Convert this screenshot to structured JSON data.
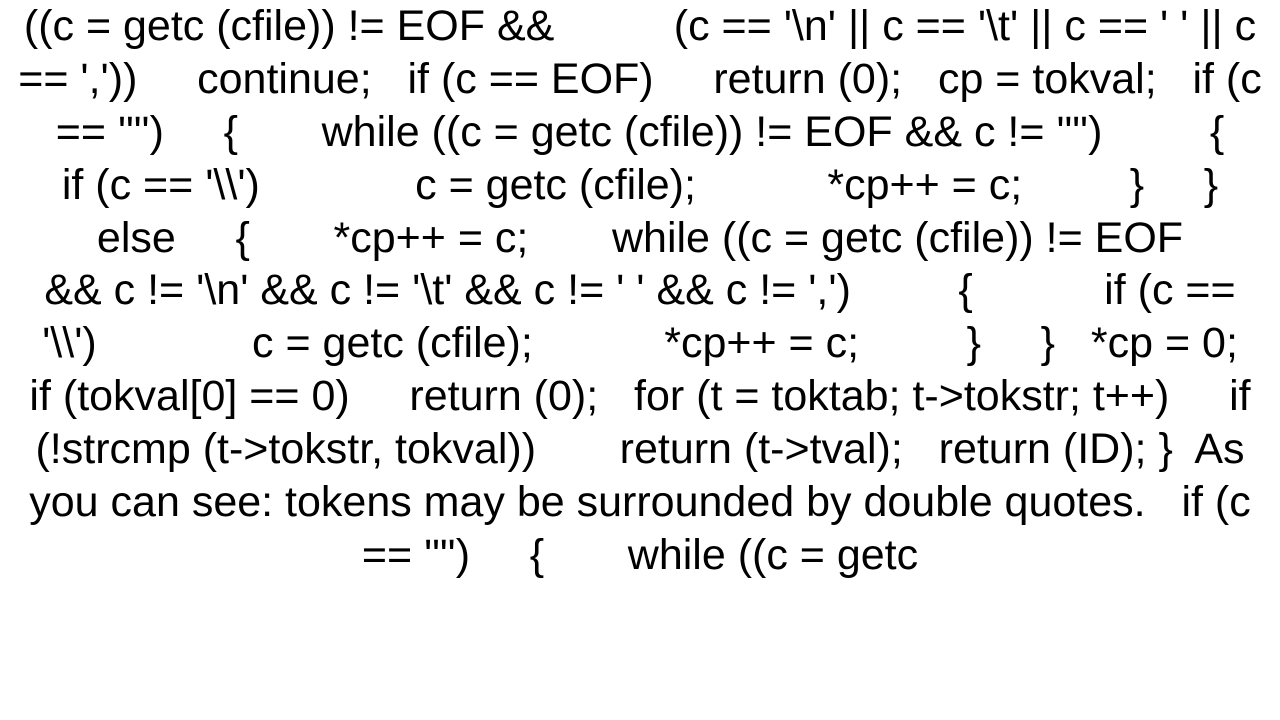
{
  "paragraph": "((c = getc (cfile)) != EOF &&          (c == '\\n' || c == '\\t' || c == ' ' || c == ','))     continue;   if (c == EOF)     return (0);   cp = tokval;   if (c == '\"')     {       while ((c = getc (cfile)) != EOF && c != '\"')         {           if (c == '\\\\')             c = getc (cfile);           *cp++ = c;         }     }   else     {       *cp++ = c;       while ((c = getc (cfile)) != EOF              && c != '\\n' && c != '\\t' && c != ' ' && c != ',')         {           if (c == '\\\\')             c = getc (cfile);           *cp++ = c;         }     }   *cp = 0;   if (tokval[0] == 0)     return (0);   for (t = toktab; t->tokstr; t++)     if (!strcmp (t->tokstr, tokval))       return (t->tval);   return (ID); }  As you can see: tokens may be surrounded by double quotes.   if (c == '\"')     {       while ((c = getc"
}
